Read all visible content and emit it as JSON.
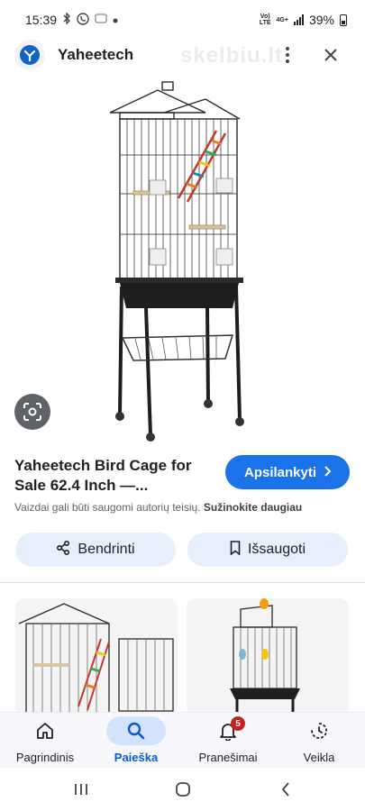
{
  "status_bar": {
    "time": "15:39",
    "network_top": "Vo)",
    "network_mid": "LTE",
    "network_4g": "4G+",
    "battery": "39%"
  },
  "header": {
    "site_name": "Yaheetech",
    "watermark": "skelbiu.lt",
    "menu_icon": "more-vert-icon",
    "close_icon": "close-icon"
  },
  "result": {
    "title": "Yaheetech Bird Cage for Sale 62.4 Inch —...",
    "visit_label": "Apsilankyti",
    "copyright_text": "Vaizdai gali būti saugomi autorių teisių.",
    "learn_more": "Sužinokite daugiau",
    "share_label": "Bendrinti",
    "save_label": "Išsaugoti"
  },
  "bottom_nav": {
    "items": [
      {
        "label": "Pagrindinis",
        "icon": "home-icon"
      },
      {
        "label": "Paieška",
        "icon": "search-icon"
      },
      {
        "label": "Pranešimai",
        "icon": "bell-icon",
        "badge": "5"
      },
      {
        "label": "Veikla",
        "icon": "activity-icon"
      }
    ],
    "active_index": 1
  },
  "colors": {
    "accent": "#1a73e8",
    "tonal_button": "#e8effc",
    "active_pill": "#d3e3fd",
    "badge": "#c5221f"
  }
}
